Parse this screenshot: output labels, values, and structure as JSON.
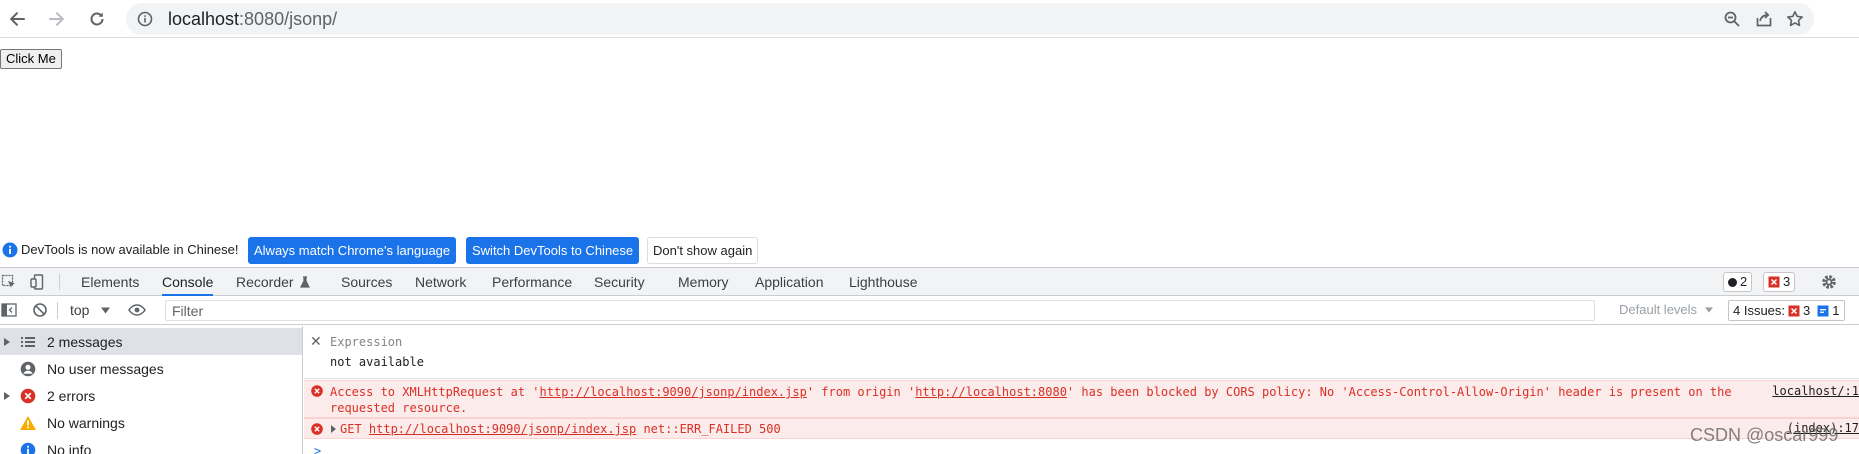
{
  "browser": {
    "url_host": "localhost",
    "url_rest": ":8080/jsonp/"
  },
  "page": {
    "button_label": "Click Me"
  },
  "infobar": {
    "message": "DevTools is now available in Chinese!",
    "btn_match_language": "Always match Chrome's language",
    "btn_switch_chinese": "Switch DevTools to Chinese",
    "btn_dont_show": "Don't show again"
  },
  "devtools": {
    "tabs": {
      "elements": "Elements",
      "console": "Console",
      "recorder": "Recorder",
      "sources": "Sources",
      "network": "Network",
      "performance": "Performance",
      "security": "Security",
      "memory": "Memory",
      "application": "Application",
      "lighthouse": "Lighthouse"
    },
    "badges": {
      "messages_count": "2",
      "errors_count": "3"
    }
  },
  "console_toolbar": {
    "context": "top",
    "filter_placeholder": "Filter",
    "levels": "Default levels",
    "issues_label": "4 Issues:",
    "issues_errors": "3",
    "issues_info": "1"
  },
  "sidebar": {
    "items": [
      {
        "label": "2 messages",
        "icon": "list-icon"
      },
      {
        "label": "No user messages",
        "icon": "user-icon"
      },
      {
        "label": "2 errors",
        "icon": "error-icon"
      },
      {
        "label": "No warnings",
        "icon": "warning-icon"
      },
      {
        "label": "No info",
        "icon": "info-icon"
      }
    ]
  },
  "console": {
    "expression_label": "Expression",
    "expression_value": "not available",
    "error1": {
      "part1": "Access to XMLHttpRequest at '",
      "url1": "http://localhost:9090/jsonp/index.jsp",
      "part2": "' from origin '",
      "url2": "http://localhost:8080",
      "part3": "' has been blocked by CORS policy: No 'Access-Control-Allow-Origin' header is present on the",
      "line2": "requested resource.",
      "source": "localhost/:1"
    },
    "error2": {
      "method": "GET ",
      "url": "http://localhost:9090/jsonp/index.jsp",
      "status": " net::ERR_FAILED 500",
      "source": "(index):17"
    },
    "prompt": ">"
  },
  "watermark": "CSDN @oscar999",
  "colors": {
    "accent": "#1a73e8",
    "error": "#d93025",
    "error_bg": "#fcebeb",
    "warning": "#f9ab00"
  }
}
